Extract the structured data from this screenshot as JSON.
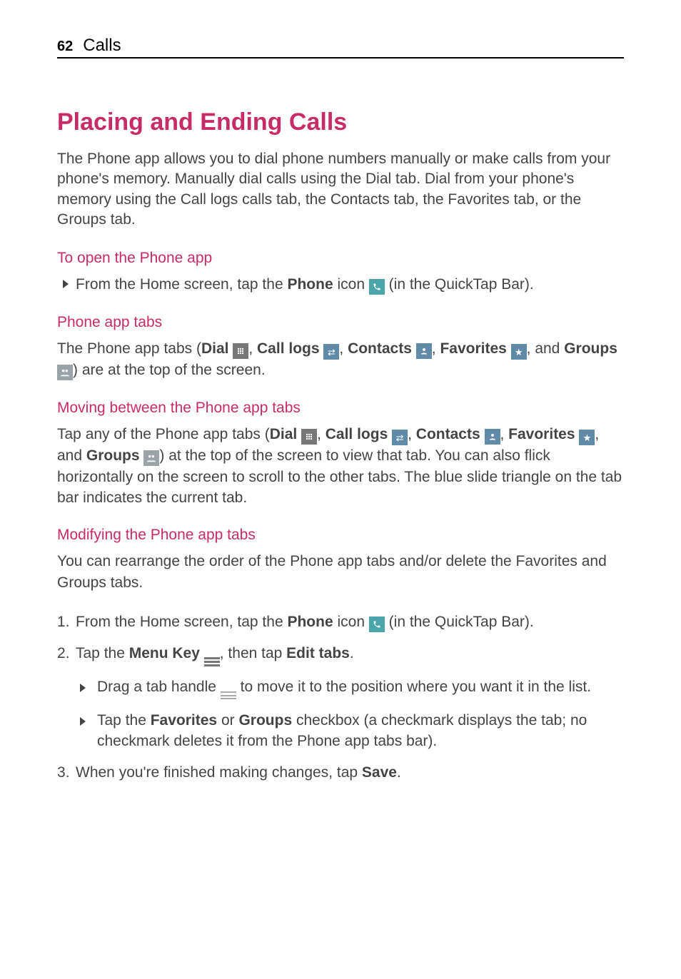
{
  "header": {
    "page_number": "62",
    "section": "Calls"
  },
  "main_heading": "Placing and Ending Calls",
  "intro": "The Phone app allows you to dial phone numbers manually or make calls from your phone's memory. Manually dial calls using the Dial tab. Dial from your phone's memory using the Call logs calls tab, the Contacts tab, the Favorites tab, or the Groups tab.",
  "s1": {
    "heading": "To open the Phone app",
    "pre": "From the Home screen, tap the ",
    "phone": "Phone",
    "mid": " icon ",
    "post": " (in the QuickTap Bar)."
  },
  "s2": {
    "heading": "Phone app tabs",
    "pre": "The Phone app tabs (",
    "dial": "Dial",
    "c": ", ",
    "calllogs": "Call logs",
    "contacts": "Contacts",
    "favorites": "Favorites",
    "and": ", and ",
    "groups": "Groups",
    "post": ") are at the top of the screen."
  },
  "s3": {
    "heading": "Moving between the Phone app tabs",
    "pre": "Tap any of the Phone app tabs (",
    "dial": "Dial",
    "c": ", ",
    "calllogs": "Call logs",
    "contacts": "Contacts",
    "favorites": "Favorites",
    "and": ", and ",
    "groups": "Groups",
    "post": ") at the top of the screen to view that tab. You can also flick horizontally on the screen to scroll to the other tabs. The blue slide triangle on the tab bar indicates the current tab."
  },
  "s4": {
    "heading": "Modifying the Phone app tabs",
    "intro": "You can rearrange the order of the Phone app tabs and/or delete the Favorites and Groups tabs.",
    "step1": {
      "pre": "From the Home screen, tap the ",
      "phone": "Phone",
      "mid": " icon ",
      "post": " (in the QuickTap Bar)."
    },
    "step2": {
      "pre": "Tap the ",
      "menukey": "Menu Key",
      "mid": ", then tap ",
      "edittabs": "Edit tabs",
      "post": "."
    },
    "sb1": {
      "pre": "Drag a tab handle ",
      "post": " to move it to the position where you want it in the list."
    },
    "sb2": {
      "pre": "Tap the ",
      "fav": "Favorites",
      "or": " or ",
      "groups": "Groups",
      "post": " checkbox (a checkmark displays the tab; no checkmark deletes it from the Phone app tabs bar)."
    },
    "step3": {
      "pre": "When you're finished making changes, tap ",
      "save": "Save",
      "post": "."
    }
  }
}
